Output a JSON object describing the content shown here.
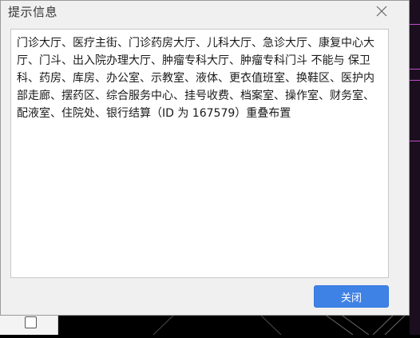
{
  "dialog": {
    "title": "提示信息",
    "message": "门诊大厅、医疗主街、门诊药房大厅、儿科大厅、急诊大厅、康复中心大厅、门斗、出入院办理大厅、肿瘤专科大厅、肿瘤专科门斗 不能与 保卫科、药房、库房、办公室、示教室、液体、更衣值班室、换鞋区、医护内部走廊、摆药区、综合服务中心、挂号收费、档案室、操作室、财务室、配液室、住院处、银行结算（ID 为 167579）重叠布置",
    "close_button_label": "关闭"
  },
  "icons": {
    "close": "close-icon"
  },
  "colors": {
    "button_bg": "#3f82e6",
    "dialog_bg": "#f0f0f0",
    "text_area_bg": "#ffffff",
    "cad_accent": "#c04cc8"
  }
}
